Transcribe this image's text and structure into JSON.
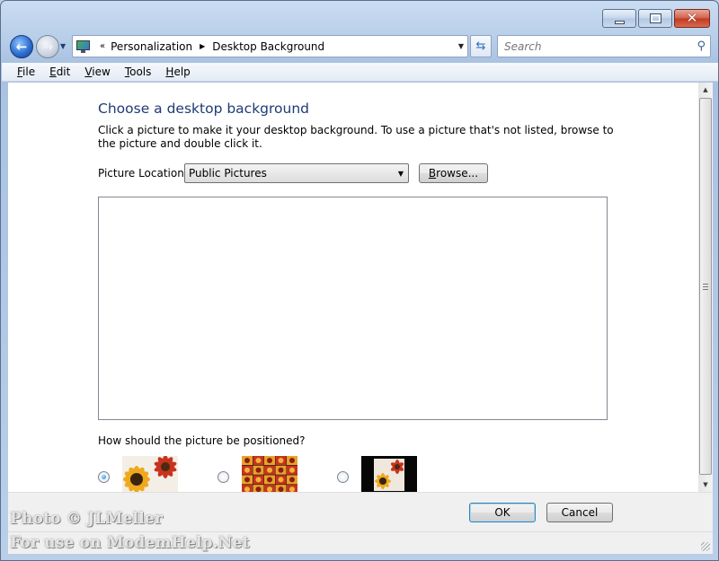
{
  "address": {
    "overflow": "«",
    "crumbs": [
      "Personalization",
      "Desktop Background"
    ]
  },
  "search": {
    "placeholder": "Search"
  },
  "menu": {
    "file": {
      "mnemonic": "F",
      "rest": "ile"
    },
    "edit": {
      "mnemonic": "E",
      "rest": "dit"
    },
    "view": {
      "mnemonic": "V",
      "rest": "iew"
    },
    "tools": {
      "mnemonic": "T",
      "rest": "ools"
    },
    "help": {
      "mnemonic": "H",
      "rest": "elp"
    }
  },
  "main": {
    "heading": "Choose a desktop background",
    "description": "Click a picture to make it your desktop background. To use a picture that's not listed, browse to the picture and double click it.",
    "location_label": "Picture Location",
    "location_value": "Public Pictures",
    "browse_label_mnemonic": "B",
    "browse_label_rest": "rowse...",
    "position_question": "How should the picture be positioned?",
    "position_options": [
      {
        "name": "fit-to-screen",
        "selected": true
      },
      {
        "name": "tile",
        "selected": false
      },
      {
        "name": "center",
        "selected": false
      }
    ]
  },
  "footer": {
    "ok_label": "OK",
    "cancel_label": "Cancel"
  },
  "watermark": {
    "line1": "Photo © JLMeller",
    "line2": "For use on ModemHelp.Net"
  },
  "colors": {
    "heading": "#1e3c73",
    "window_frame": "#b9cfe9",
    "close_button": "#c0391f"
  },
  "icons": [
    "back-arrow-icon",
    "forward-arrow-icon",
    "personalization-monitor-icon",
    "refresh-icon",
    "search-icon",
    "close-icon",
    "minimize-icon",
    "maximize-icon"
  ]
}
